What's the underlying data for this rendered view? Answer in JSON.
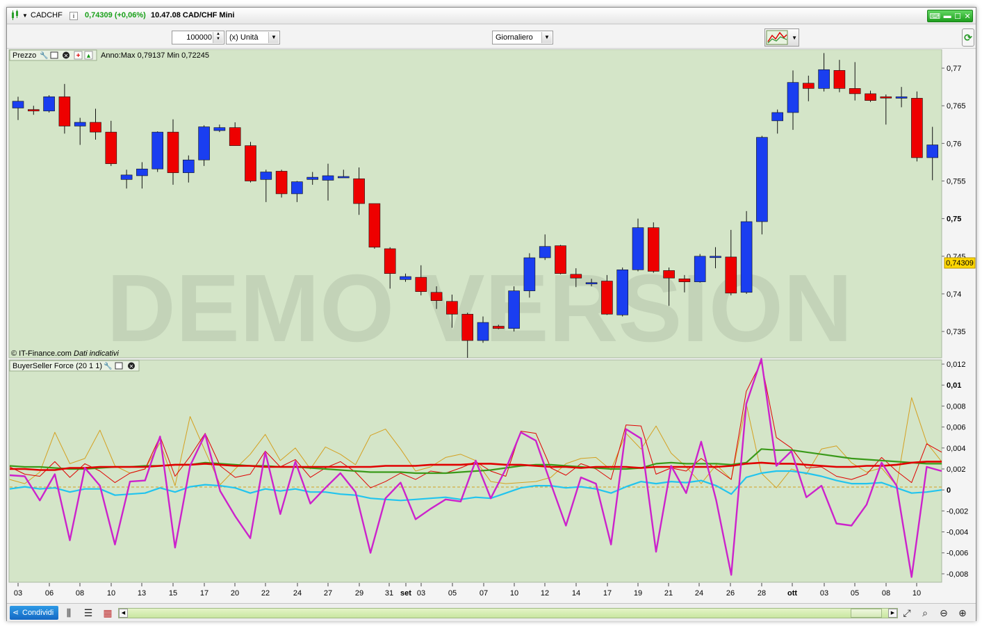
{
  "titlebar": {
    "symbol": "CADCHF",
    "info_icon": "i",
    "last_price": "0,74309 (+0,06%)",
    "time_desc": "10.47.08 CAD/CHF Mini"
  },
  "toolbar": {
    "quantity": "100000",
    "unit": "(x) Unità",
    "timeframe": "Giornaliero"
  },
  "price_panel": {
    "title": "Prezzo",
    "range": "Anno:Max 0,79137 Min 0,72245",
    "watermark": "DEMO VERSION",
    "credit": "© IT-Finance.com",
    "credit_note": "Dati indicativi",
    "current_price_label": "0,74309",
    "y_ticks": [
      "0,77",
      "0,765",
      "0,76",
      "0,755",
      "0,75",
      "0,745",
      "0,74",
      "0,735"
    ]
  },
  "indicator_panel": {
    "title": "BuyerSeller Force (20 1 1)",
    "y_ticks": [
      "0,012",
      "0,01",
      "0,008",
      "0,006",
      "0,004",
      "0,002",
      "0",
      "-0,002",
      "-0,004",
      "-0,006",
      "-0,008"
    ]
  },
  "x_axis": {
    "labels": [
      "03",
      "06",
      "08",
      "10",
      "13",
      "15",
      "17",
      "20",
      "22",
      "24",
      "27",
      "29",
      "31",
      "set",
      "03",
      "05",
      "07",
      "10",
      "12",
      "14",
      "17",
      "19",
      "21",
      "24",
      "26",
      "28",
      "ott",
      "03",
      "05",
      "08",
      "10"
    ]
  },
  "bottombar": {
    "share_label": "Condividi"
  },
  "colors": {
    "bull": "#1a3ef0",
    "bear": "#ee0000",
    "panel_bg": "#d4e5c8",
    "price_label_bg": "#ffd700",
    "magenta": "#cc22cc",
    "cyan": "#22c4ee",
    "green": "#3a9a1a",
    "red": "#e00000",
    "orange": "#d4a020"
  },
  "chart_data": [
    {
      "type": "candlestick",
      "series_bull_color": "blue",
      "series_bear_color": "red",
      "ylim": [
        0.7315,
        0.7725
      ],
      "candles": [
        {
          "o": 0.7647,
          "h": 0.7662,
          "l": 0.7631,
          "c": 0.7656
        },
        {
          "o": 0.7645,
          "h": 0.765,
          "l": 0.7638,
          "c": 0.7643
        },
        {
          "o": 0.7643,
          "h": 0.7664,
          "l": 0.7641,
          "c": 0.7662
        },
        {
          "o": 0.7662,
          "h": 0.7679,
          "l": 0.7613,
          "c": 0.7623
        },
        {
          "o": 0.7623,
          "h": 0.7634,
          "l": 0.7598,
          "c": 0.7628
        },
        {
          "o": 0.7628,
          "h": 0.7646,
          "l": 0.7605,
          "c": 0.7615
        },
        {
          "o": 0.7615,
          "h": 0.763,
          "l": 0.757,
          "c": 0.7573
        },
        {
          "o": 0.7552,
          "h": 0.7565,
          "l": 0.754,
          "c": 0.7558
        },
        {
          "o": 0.7557,
          "h": 0.7575,
          "l": 0.754,
          "c": 0.7566
        },
        {
          "o": 0.7566,
          "h": 0.7616,
          "l": 0.7562,
          "c": 0.7615
        },
        {
          "o": 0.7615,
          "h": 0.7632,
          "l": 0.7545,
          "c": 0.7561
        },
        {
          "o": 0.7561,
          "h": 0.7584,
          "l": 0.7548,
          "c": 0.7578
        },
        {
          "o": 0.7578,
          "h": 0.7624,
          "l": 0.757,
          "c": 0.7622
        },
        {
          "o": 0.7617,
          "h": 0.7625,
          "l": 0.7615,
          "c": 0.7621
        },
        {
          "o": 0.7621,
          "h": 0.7628,
          "l": 0.7598,
          "c": 0.7597
        },
        {
          "o": 0.7597,
          "h": 0.7602,
          "l": 0.7548,
          "c": 0.755
        },
        {
          "o": 0.7552,
          "h": 0.7565,
          "l": 0.7522,
          "c": 0.7562
        },
        {
          "o": 0.7563,
          "h": 0.7565,
          "l": 0.7528,
          "c": 0.7533
        },
        {
          "o": 0.7533,
          "h": 0.755,
          "l": 0.7522,
          "c": 0.7549
        },
        {
          "o": 0.7552,
          "h": 0.7562,
          "l": 0.7545,
          "c": 0.7555
        },
        {
          "o": 0.7551,
          "h": 0.7573,
          "l": 0.7524,
          "c": 0.7557
        },
        {
          "o": 0.7555,
          "h": 0.7565,
          "l": 0.7555,
          "c": 0.7556
        },
        {
          "o": 0.7553,
          "h": 0.7568,
          "l": 0.7505,
          "c": 0.752
        },
        {
          "o": 0.752,
          "h": 0.752,
          "l": 0.746,
          "c": 0.7462
        },
        {
          "o": 0.746,
          "h": 0.7462,
          "l": 0.7407,
          "c": 0.7427
        },
        {
          "o": 0.7419,
          "h": 0.7427,
          "l": 0.7416,
          "c": 0.7423
        },
        {
          "o": 0.7422,
          "h": 0.7438,
          "l": 0.7398,
          "c": 0.7403
        },
        {
          "o": 0.7402,
          "h": 0.741,
          "l": 0.738,
          "c": 0.7391
        },
        {
          "o": 0.739,
          "h": 0.7399,
          "l": 0.7355,
          "c": 0.7373
        },
        {
          "o": 0.7373,
          "h": 0.7375,
          "l": 0.7315,
          "c": 0.7338
        },
        {
          "o": 0.7338,
          "h": 0.737,
          "l": 0.7335,
          "c": 0.7362
        },
        {
          "o": 0.7357,
          "h": 0.7359,
          "l": 0.7353,
          "c": 0.7354
        },
        {
          "o": 0.7354,
          "h": 0.741,
          "l": 0.735,
          "c": 0.7404
        },
        {
          "o": 0.7404,
          "h": 0.7454,
          "l": 0.7395,
          "c": 0.7448
        },
        {
          "o": 0.7448,
          "h": 0.7479,
          "l": 0.7445,
          "c": 0.7463
        },
        {
          "o": 0.7464,
          "h": 0.7465,
          "l": 0.7426,
          "c": 0.7427
        },
        {
          "o": 0.7426,
          "h": 0.7434,
          "l": 0.7409,
          "c": 0.7421
        },
        {
          "o": 0.7414,
          "h": 0.742,
          "l": 0.741,
          "c": 0.7415
        },
        {
          "o": 0.7417,
          "h": 0.7425,
          "l": 0.7372,
          "c": 0.7373
        },
        {
          "o": 0.7372,
          "h": 0.7435,
          "l": 0.737,
          "c": 0.7432
        },
        {
          "o": 0.7432,
          "h": 0.75,
          "l": 0.743,
          "c": 0.7488
        },
        {
          "o": 0.7488,
          "h": 0.7495,
          "l": 0.7428,
          "c": 0.743
        },
        {
          "o": 0.7431,
          "h": 0.7435,
          "l": 0.7384,
          "c": 0.7421
        },
        {
          "o": 0.742,
          "h": 0.7425,
          "l": 0.7402,
          "c": 0.7416
        },
        {
          "o": 0.7416,
          "h": 0.7453,
          "l": 0.7415,
          "c": 0.745
        },
        {
          "o": 0.745,
          "h": 0.7462,
          "l": 0.7434,
          "c": 0.745
        },
        {
          "o": 0.7449,
          "h": 0.7485,
          "l": 0.7398,
          "c": 0.7401
        },
        {
          "o": 0.7402,
          "h": 0.751,
          "l": 0.74,
          "c": 0.7496
        },
        {
          "o": 0.7496,
          "h": 0.761,
          "l": 0.7479,
          "c": 0.7608
        },
        {
          "o": 0.763,
          "h": 0.7645,
          "l": 0.7613,
          "c": 0.7641
        },
        {
          "o": 0.7641,
          "h": 0.7697,
          "l": 0.7618,
          "c": 0.7681
        },
        {
          "o": 0.768,
          "h": 0.769,
          "l": 0.7656,
          "c": 0.7673
        },
        {
          "o": 0.7673,
          "h": 0.772,
          "l": 0.7669,
          "c": 0.7698
        },
        {
          "o": 0.7697,
          "h": 0.7711,
          "l": 0.7668,
          "c": 0.7673
        },
        {
          "o": 0.7673,
          "h": 0.7708,
          "l": 0.7657,
          "c": 0.7666
        },
        {
          "o": 0.7666,
          "h": 0.767,
          "l": 0.7655,
          "c": 0.7657
        },
        {
          "o": 0.7662,
          "h": 0.7665,
          "l": 0.7625,
          "c": 0.7661
        },
        {
          "o": 0.766,
          "h": 0.7675,
          "l": 0.7648,
          "c": 0.7662
        },
        {
          "o": 0.766,
          "h": 0.7669,
          "l": 0.7576,
          "c": 0.7581
        },
        {
          "o": 0.7581,
          "h": 0.7622,
          "l": 0.7551,
          "c": 0.7598
        }
      ]
    },
    {
      "type": "line",
      "ylim": [
        -0.0088,
        0.0124
      ],
      "series": [
        {
          "color": "magenta",
          "values": [
            0.0014,
            0.0013,
            -0.001,
            0.0015,
            -0.0048,
            0.0021,
            0.0004,
            -0.0052,
            0.0008,
            0.0009,
            0.0051,
            -0.0055,
            0.0023,
            0.0053,
            -0.0001,
            -0.0025,
            -0.0046,
            0.0036,
            -0.0023,
            0.0027,
            -0.0013,
            0.0002,
            0.0016,
            -0.0002,
            -0.006,
            -0.0008,
            0.0007,
            -0.0028,
            -0.0018,
            -0.0009,
            -0.0011,
            0.0028,
            -0.0008,
            0.002,
            0.0055,
            0.0047,
            0.0006,
            -0.0034,
            0.0012,
            0.0006,
            -0.0052,
            0.0058,
            0.0049,
            -0.0059,
            0.0023,
            -0.0003,
            0.0046,
            -0.001,
            -0.0081,
            0.0082,
            0.0125,
            0.0023,
            0.0037,
            -0.0007,
            0.0004,
            -0.0032,
            -0.0034,
            -0.0014,
            0.0026,
            0.0004,
            -0.0083,
            0.0022,
            0.0018
          ]
        },
        {
          "color": "cyan",
          "values": [
            0.0001,
            0.0003,
            0.0001,
            0.0002,
            -0.0002,
            0.0001,
            0.0001,
            -0.0005,
            -0.0004,
            -0.0003,
            0.0002,
            -0.0002,
            0.0003,
            0.0005,
            0.0004,
            0.0002,
            -0.0003,
            0.0001,
            -0.0001,
            0.0001,
            -0.0002,
            -0.0002,
            -0.0004,
            -0.0005,
            -0.0008,
            -0.0009,
            -0.001,
            -0.0009,
            -0.0008,
            -0.0007,
            -0.0009,
            -0.0007,
            -0.0008,
            -0.0003,
            0.0002,
            0.0004,
            0.0004,
            0.0002,
            0.0003,
            0.0001,
            -0.0003,
            0.0003,
            0.0008,
            0.0006,
            0.0008,
            0.0007,
            0.0009,
            0.0004,
            -0.0004,
            0.0012,
            0.0016,
            0.0018,
            0.0018,
            0.0016,
            0.0013,
            0.0009,
            0.0006,
            0.0006,
            0.0007,
            0.0002,
            -0.0003,
            -0.0002,
            0.0
          ]
        },
        {
          "color": "green",
          "values": [
            0.0023,
            0.0022,
            0.0022,
            0.0021,
            0.002,
            0.002,
            0.0021,
            0.0022,
            0.0022,
            0.0023,
            0.0023,
            0.0024,
            0.0024,
            0.0026,
            0.0025,
            0.0024,
            0.0023,
            0.0023,
            0.0022,
            0.0022,
            0.0021,
            0.002,
            0.0019,
            0.0018,
            0.0017,
            0.0017,
            0.0017,
            0.0016,
            0.0016,
            0.0016,
            0.0017,
            0.0018,
            0.0019,
            0.0021,
            0.0023,
            0.0024,
            0.0024,
            0.0023,
            0.0022,
            0.0021,
            0.002,
            0.002,
            0.0021,
            0.0025,
            0.0026,
            0.0025,
            0.0025,
            0.0025,
            0.0024,
            0.0026,
            0.0039,
            0.0038,
            0.0038,
            0.0036,
            0.0034,
            0.0032,
            0.003,
            0.0029,
            0.0028,
            0.0027,
            0.0026,
            0.0025,
            0.0025
          ]
        },
        {
          "color": "red",
          "values": [
            0.002,
            0.002,
            0.0019,
            0.0019,
            0.0021,
            0.0021,
            0.0022,
            0.0022,
            0.0022,
            0.0022,
            0.0023,
            0.0024,
            0.0024,
            0.0025,
            0.0024,
            0.0023,
            0.0023,
            0.0022,
            0.0022,
            0.0022,
            0.0022,
            0.0022,
            0.0022,
            0.0022,
            0.0022,
            0.0023,
            0.0023,
            0.0023,
            0.0024,
            0.0024,
            0.0024,
            0.0025,
            0.0025,
            0.0024,
            0.0024,
            0.0023,
            0.0022,
            0.0022,
            0.0021,
            0.0022,
            0.0022,
            0.0022,
            0.0021,
            0.0022,
            0.0022,
            0.0022,
            0.0022,
            0.0022,
            0.0023,
            0.0025,
            0.0026,
            0.0025,
            0.0025,
            0.0024,
            0.0023,
            0.0022,
            0.0022,
            0.0023,
            0.0023,
            0.0024,
            0.0026,
            0.0027,
            0.0027
          ]
        },
        {
          "color": "thin-red",
          "values": [
            0.0022,
            0.0015,
            0.0013,
            0.0027,
            0.0012,
            0.0025,
            0.0018,
            0.0007,
            0.0016,
            0.002,
            0.0051,
            0.0013,
            0.0032,
            0.0054,
            0.0023,
            0.0012,
            0.0015,
            0.0037,
            0.0022,
            0.0029,
            0.0012,
            0.0021,
            0.0027,
            0.0017,
            0.0002,
            0.0008,
            0.0016,
            0.001,
            0.0018,
            0.0016,
            0.0021,
            0.0027,
            0.0018,
            0.0013,
            0.0056,
            0.0054,
            0.0021,
            0.0014,
            0.0025,
            0.002,
            0.001,
            0.0062,
            0.0061,
            0.0015,
            0.0021,
            0.0018,
            0.003,
            0.002,
            0.001,
            0.0094,
            0.0122,
            0.005,
            0.004,
            0.0021,
            0.0022,
            0.0013,
            0.001,
            0.0015,
            0.0031,
            0.0018,
            0.0007,
            0.0044,
            0.0036
          ]
        },
        {
          "color": "orange",
          "values": [
            0.001,
            0.0006,
            0.0017,
            0.0055,
            0.0025,
            0.003,
            0.0057,
            0.0023,
            0.0016,
            0.002,
            0.0045,
            0.0004,
            0.007,
            0.0037,
            0.0005,
            0.002,
            0.0034,
            0.0053,
            0.0028,
            0.004,
            0.002,
            0.0041,
            0.0034,
            0.0024,
            0.0052,
            0.0058,
            0.0039,
            0.0018,
            0.0022,
            0.0031,
            0.0034,
            0.0028,
            0.0008,
            0.0006,
            0.0007,
            0.0008,
            0.0012,
            0.0025,
            0.003,
            0.0031,
            0.0019,
            0.0054,
            0.0039,
            0.0061,
            0.0035,
            0.0022,
            0.0006,
            0.0024,
            0.001,
            0.0082,
            0.0016,
            0.0002,
            0.002,
            0.0015,
            0.0039,
            0.0042,
            0.0026,
            0.0017,
            0.0021,
            0.0004,
            0.0088,
            0.0045,
            0.0027
          ]
        }
      ]
    }
  ]
}
